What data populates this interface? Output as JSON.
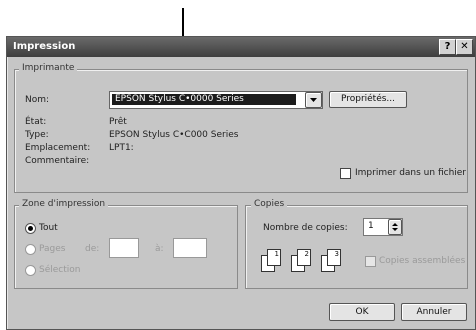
{
  "window": {
    "title": "Impression",
    "help_glyph": "?",
    "close_glyph": "✕"
  },
  "printer": {
    "group_label": "Imprimante",
    "name_label": "Nom:",
    "name_value": "EPSON Stylus C•0000 Series",
    "properties_button": "Propriétés...",
    "status_label": "État:",
    "status_value": "Prêt",
    "type_label": "Type:",
    "type_value": "EPSON Stylus C•C000 Series",
    "location_label": "Emplacement:",
    "location_value": "LPT1:",
    "comment_label": "Commentaire:",
    "print_to_file_label": "Imprimer dans un fichier"
  },
  "range": {
    "group_label": "Zone d'impression",
    "all_label": "Tout",
    "pages_label": "Pages",
    "from_label": "de:",
    "to_label": "à:",
    "selection_label": "Sélection"
  },
  "copies": {
    "group_label": "Copies",
    "count_label": "Nombre de copies:",
    "count_value": "1",
    "collate_label": "Copies assemblées",
    "page_numbers": [
      "1",
      "1",
      "2",
      "2",
      "3",
      "3"
    ]
  },
  "footer": {
    "ok_label": "OK",
    "cancel_label": "Annuler"
  }
}
